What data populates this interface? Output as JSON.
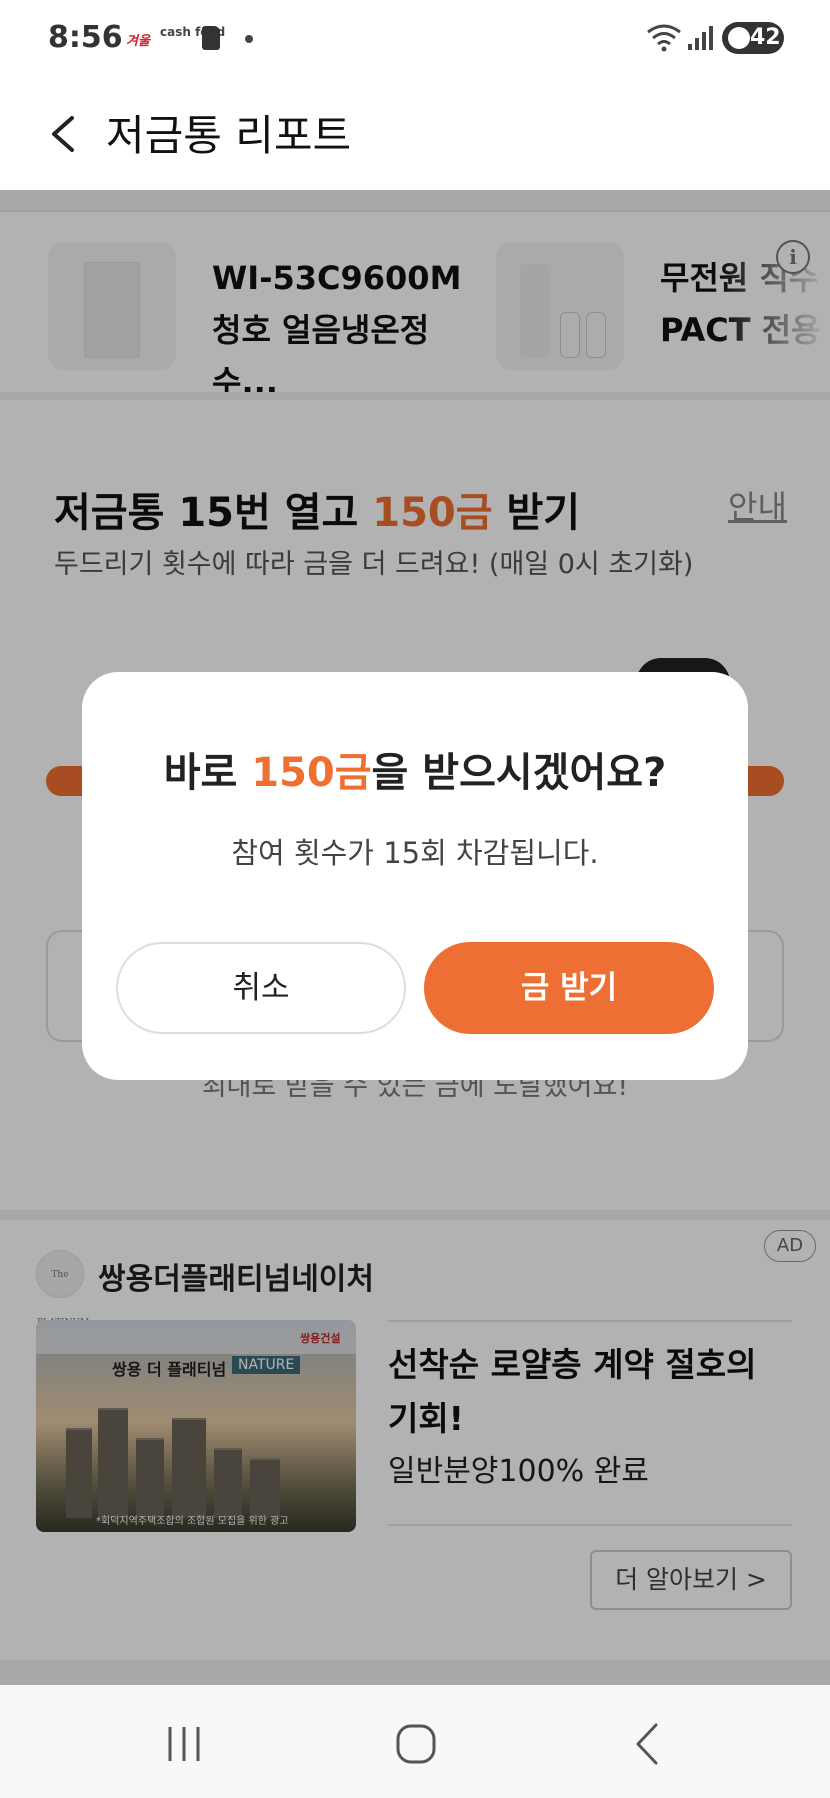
{
  "status_bar": {
    "time": "8:56",
    "app_badge_1": "겨울",
    "app_badge_2": "cash feed",
    "battery": "42"
  },
  "header": {
    "title": "저금통 리포트"
  },
  "products": [
    {
      "name": "WI-53C9600M 청호 얼음냉온정수..."
    },
    {
      "name": "무전원 직수 PACT 전용"
    }
  ],
  "piggy": {
    "title_prefix": "저금통 15번 열고 ",
    "title_accent": "150금",
    "title_suffix": " 받기",
    "guide_link": "안내",
    "subtitle": "두드리기 횟수에 따라 금을 더 드려요! (매일 0시 초기화)",
    "progress": 1.0,
    "max_message": "최대로 받을 수 있는 금에 도달했어요!"
  },
  "ad": {
    "badge": "AD",
    "logo_text": "The PLATINUM",
    "advertiser": "쌍용더플래티넘네이처",
    "image_title": "쌍용 더 플래티넘",
    "image_tag": "NATURE",
    "image_brand": "쌍용건설",
    "image_footnote": "*회덕지역주택조합의 조합원 모집을 위한 광고",
    "headline": "선착순 로얄층 계약 절호의 기회!",
    "description": "일반분양100% 완료",
    "more_button": "더 알아보기 >"
  },
  "dialog": {
    "title_prefix": "바로 ",
    "title_accent": "150금",
    "title_suffix": "을 받으시겠어요?",
    "message": "참여 횟수가 15회 차감됩니다.",
    "cancel_label": "취소",
    "confirm_label": "금 받기"
  },
  "colors": {
    "accent": "#ee6f33",
    "dim_overlay": "rgba(0,0,0,0.30)"
  },
  "icons": [
    "back-arrow-icon",
    "info-icon",
    "wifi-icon",
    "signal-icon",
    "battery-icon",
    "recent-apps-icon",
    "home-icon",
    "nav-back-icon"
  ]
}
